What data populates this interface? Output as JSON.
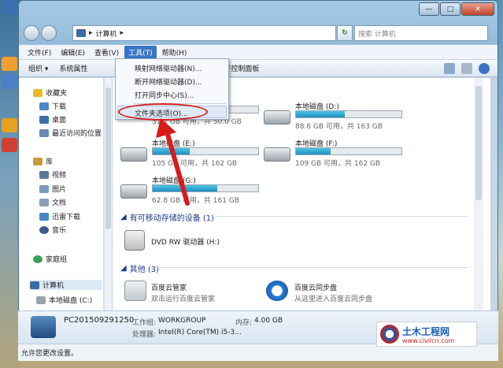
{
  "window": {
    "caption_buttons": {
      "minimize": "—",
      "maximize": "□",
      "close": "✕"
    }
  },
  "nav": {
    "breadcrumb": [
      "计算机"
    ],
    "search_placeholder": "搜索 计算机"
  },
  "menubar": [
    {
      "label": "文件(F)"
    },
    {
      "label": "编辑(E)"
    },
    {
      "label": "查看(V)"
    },
    {
      "label": "工具(T)",
      "active": true
    },
    {
      "label": "帮助(H)"
    }
  ],
  "toolbar": {
    "organize": "组织 ▾",
    "system_props": "系统属性",
    "control_panel": "打开控制面板"
  },
  "tools_menu": {
    "items": [
      "映射网络驱动器(N)...",
      "断开网络驱动器(D)...",
      "打开同步中心(S)...",
      "文件夹选项(O)..."
    ]
  },
  "sidebar": {
    "favorites": "收藏夹",
    "download": "下载",
    "desktop": "桌面",
    "recent": "最近访问的位置",
    "library": "库",
    "video": "视频",
    "pictures": "图片",
    "docs": "文档",
    "xunlei": "迅雷下载",
    "music": "音乐",
    "homegroup": "家庭组",
    "computer": "计算机",
    "local_c": "本地磁盘 (C:)"
  },
  "drives": [
    {
      "name": "本地磁盘 (C:)",
      "info": "31.1 GB 可用，共 50.0 GB",
      "used_fraction": 0.38
    },
    {
      "name": "本地磁盘 (D:)",
      "info": "88.6 GB 可用，共 163 GB",
      "used_fraction": 0.46
    },
    {
      "name": "本地磁盘 (E:)",
      "info": "105 GB 可用，共 162 GB",
      "used_fraction": 0.35
    },
    {
      "name": "本地磁盘 (F:)",
      "info": "109 GB 可用，共 162 GB",
      "used_fraction": 0.33
    },
    {
      "name": "本地磁盘 (G:)",
      "info": "62.8 GB 可用，共 161 GB",
      "used_fraction": 0.61
    }
  ],
  "removable": {
    "header": "有可移动存储的设备 (1)",
    "dvd": "DVD RW 驱动器 (H:)"
  },
  "other": {
    "header": "其他 (3)",
    "item1_title": "百度云管家",
    "item1_sub": "双击运行百度云管家",
    "item2_title": "百度云同步盘",
    "item2_sub": "从这里进入百度云同步盘"
  },
  "details": {
    "pc_name": "PC201509291250",
    "workgroup_label": "工作组:",
    "workgroup": "WORKGROUP",
    "memory_label": "内存:",
    "memory": "4.00 GB",
    "cpu_label": "处理器:",
    "cpu": "Intel(R) Core(TM) i5-3..."
  },
  "status": "允许您更改设置。",
  "watermark": {
    "title": "土木工程网",
    "url": "www.civilcn.com"
  }
}
